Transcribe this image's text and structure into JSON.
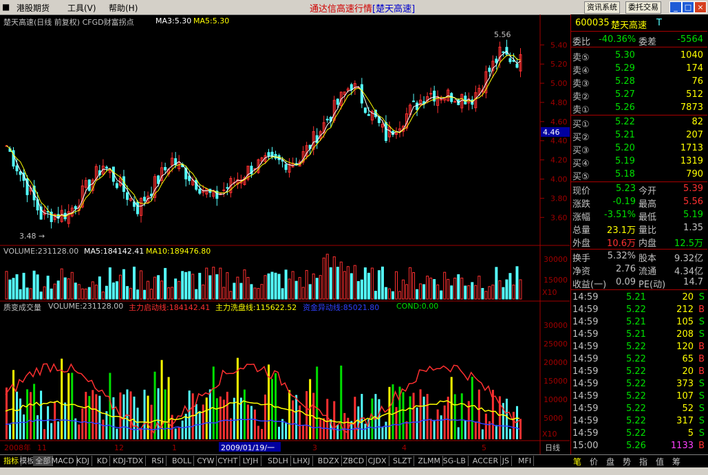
{
  "menu": [
    "港股期货",
    "工具(V)",
    "帮助(H)"
  ],
  "app_title": "通达信高速行情",
  "app_stock": "[楚天高速]",
  "toolbar": {
    "btn1": "资讯系统",
    "btn2": "委托交易"
  },
  "chart_header": {
    "name": "楚天高速(日线 前复权) CFGD财富拐点",
    "ma3": "MA3:5.30",
    "ma5": "MA5:5.30"
  },
  "price_annotations": {
    "high": "5.56",
    "low": "3.48",
    "cursor": "4.46"
  },
  "price_ticks": [
    "5.40",
    "5.20",
    "5.00",
    "4.80",
    "4.60",
    "4.40",
    "4.20",
    "4.00",
    "3.80",
    "3.60"
  ],
  "volume_header": {
    "vol": "VOLUME:231128.00",
    "ma5": "MA5:184142.41",
    "ma10": "MA10:189476.80"
  },
  "volume_ticks": [
    "30000",
    "15000"
  ],
  "volume_unit": "X10",
  "ind_header": {
    "name": "质变成交量",
    "vol": "VOLUME:231128.00",
    "l1": "主力启动线:184142.41",
    "l2": "主力洗盘线:115622.52",
    "l3": "资金异动线:85021.80",
    "cond": "COND:0.00"
  },
  "ind_ticks": [
    "30000",
    "25000",
    "20000",
    "15000",
    "10000",
    "5000"
  ],
  "ind_unit": "X10",
  "date_axis": {
    "y2008": "2008年",
    "m11": "11",
    "m12": "12",
    "m1": "1",
    "cursor_date": "2009/01/19/一",
    "m3": "3",
    "m4": "4",
    "m5": "5",
    "period": "日线"
  },
  "quote": {
    "code": "600035",
    "name": "楚天高速",
    "flag": "T",
    "weibi_label": "委比",
    "weibi": "-40.36%",
    "weicha_label": "委差",
    "weicha": "-5564",
    "asks": [
      {
        "label": "卖⑤",
        "price": "5.30",
        "vol": "1040"
      },
      {
        "label": "卖④",
        "price": "5.29",
        "vol": "174"
      },
      {
        "label": "卖③",
        "price": "5.28",
        "vol": "76"
      },
      {
        "label": "卖②",
        "price": "5.27",
        "vol": "512"
      },
      {
        "label": "卖①",
        "price": "5.26",
        "vol": "7873"
      }
    ],
    "bids": [
      {
        "label": "买①",
        "price": "5.22",
        "vol": "82"
      },
      {
        "label": "买②",
        "price": "5.21",
        "vol": "207"
      },
      {
        "label": "买③",
        "price": "5.20",
        "vol": "1713"
      },
      {
        "label": "买④",
        "price": "5.19",
        "vol": "1319"
      },
      {
        "label": "买⑤",
        "price": "5.18",
        "vol": "790"
      }
    ],
    "stats": [
      {
        "l1": "现价",
        "v1": "5.23",
        "l2": "今开",
        "v2": "5.39"
      },
      {
        "l1": "涨跌",
        "v1": "-0.19",
        "l2": "最高",
        "v2": "5.56"
      },
      {
        "l1": "涨幅",
        "v1": "-3.51%",
        "l2": "最低",
        "v2": "5.19"
      },
      {
        "l1": "总量",
        "v1": "23.1万",
        "l2": "量比",
        "v2": "1.35"
      },
      {
        "l1": "外盘",
        "v1": "10.6万",
        "l2": "内盘",
        "v2": "12.5万"
      }
    ],
    "stats2": [
      {
        "l1": "换手",
        "v1": "5.32%",
        "l2": "股本",
        "v2": "9.32亿"
      },
      {
        "l1": "净资",
        "v1": "2.76",
        "l2": "流通",
        "v2": "4.34亿"
      },
      {
        "l1": "收益(一)",
        "v1": "0.09",
        "l2": "PE(动)",
        "v2": "14.7"
      }
    ],
    "ticks": [
      {
        "t": "14:59",
        "p": "5.21",
        "v": "20",
        "s": "S"
      },
      {
        "t": "14:59",
        "p": "5.22",
        "v": "212",
        "s": "B"
      },
      {
        "t": "14:59",
        "p": "5.21",
        "v": "105",
        "s": "S"
      },
      {
        "t": "14:59",
        "p": "5.21",
        "v": "208",
        "s": "S"
      },
      {
        "t": "14:59",
        "p": "5.22",
        "v": "120",
        "s": "B"
      },
      {
        "t": "14:59",
        "p": "5.22",
        "v": "65",
        "s": "B"
      },
      {
        "t": "14:59",
        "p": "5.22",
        "v": "20",
        "s": "B"
      },
      {
        "t": "14:59",
        "p": "5.22",
        "v": "373",
        "s": "S"
      },
      {
        "t": "14:59",
        "p": "5.22",
        "v": "107",
        "s": "S"
      },
      {
        "t": "14:59",
        "p": "5.22",
        "v": "52",
        "s": "S"
      },
      {
        "t": "14:59",
        "p": "5.22",
        "v": "317",
        "s": "S"
      },
      {
        "t": "14:59",
        "p": "5.22",
        "v": "5",
        "s": "S"
      },
      {
        "t": "15:00",
        "p": "5.26",
        "v": "1133",
        "s": "B"
      }
    ]
  },
  "bottom_tabs": [
    "指标",
    "模板",
    "全部",
    "MACD",
    "KDJ",
    "KD",
    "KDJ-TDX",
    "RSI",
    "BOLL",
    "CYW",
    "CYHT",
    "LYJH",
    "SDLH",
    "LHXJ",
    "BDZX",
    "ZBCD",
    "CJDX",
    "SLZT",
    "ZLMM",
    "SG-LB",
    "ACCER",
    "JS",
    "MFI"
  ],
  "right_tabs": [
    "笔",
    "价",
    "盘",
    "势",
    "指",
    "值",
    "筹"
  ],
  "colors": {
    "up": "#ff3030",
    "down": "#54ffff",
    "equal": "#c0c0c0",
    "grid": "#a00000",
    "yellow": "#ffff00",
    "green": "#00e000",
    "magenta": "#ff40ff",
    "blue": "#3040ff"
  }
}
